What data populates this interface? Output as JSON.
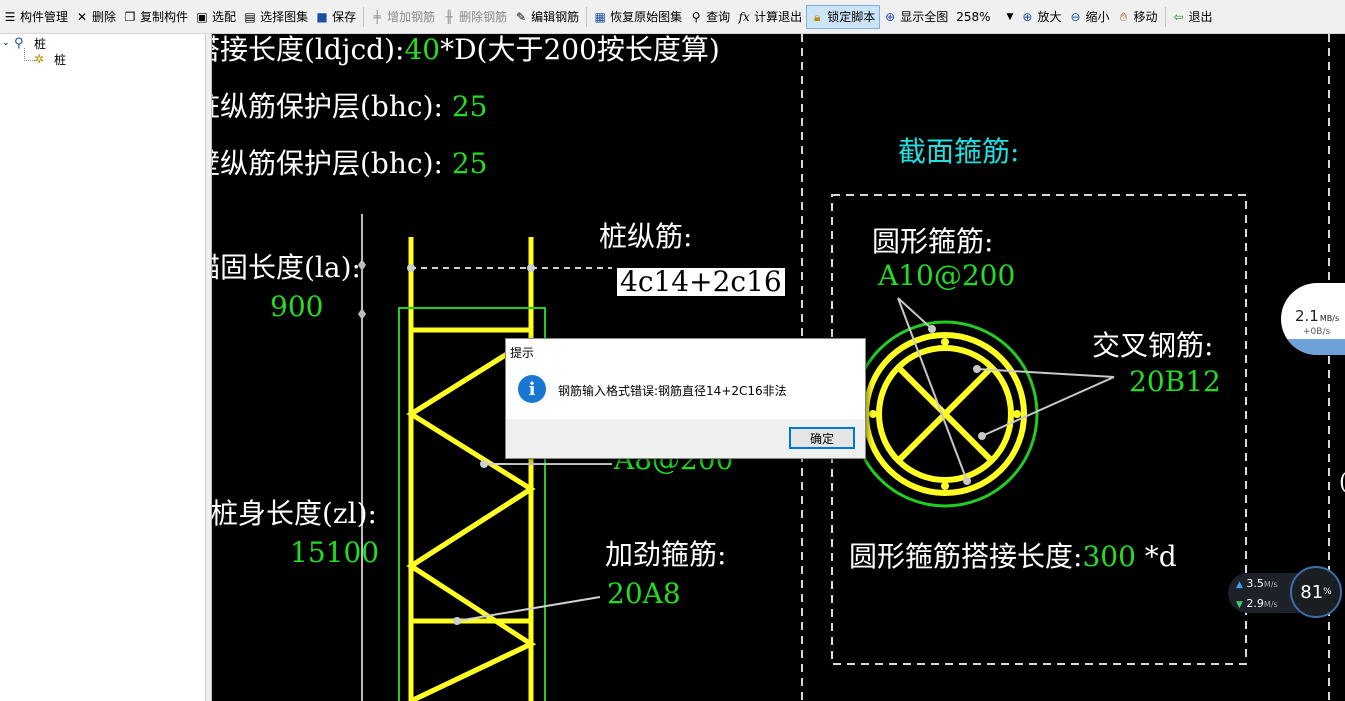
{
  "toolbar": {
    "items": [
      {
        "label": "构件管理",
        "icon": "component-manager-icon",
        "disabled": false
      },
      {
        "label": "删除",
        "icon": "delete-icon",
        "disabled": false
      },
      {
        "label": "复制构件",
        "icon": "copy-icon",
        "disabled": false
      },
      {
        "label": "选配",
        "icon": "select-match-icon",
        "disabled": false
      },
      {
        "label": "选择图集",
        "icon": "select-atlas-icon",
        "disabled": false
      },
      {
        "label": "保存",
        "icon": "save-icon",
        "disabled": false
      },
      {
        "label": "增加钢筋",
        "icon": "add-rebar-icon",
        "disabled": true
      },
      {
        "label": "删除钢筋",
        "icon": "delete-rebar-icon",
        "disabled": true
      },
      {
        "label": "编辑钢筋",
        "icon": "edit-rebar-icon",
        "disabled": false
      },
      {
        "label": "恢复原始图集",
        "icon": "restore-atlas-icon",
        "disabled": false
      },
      {
        "label": "查询",
        "icon": "query-icon",
        "disabled": false
      },
      {
        "label": "计算退出",
        "icon": "calc-exit-icon",
        "disabled": false
      },
      {
        "label": "锁定脚本",
        "icon": "lock-icon",
        "disabled": false,
        "active": true
      },
      {
        "label": "显示全图",
        "icon": "zoom-extents-icon",
        "disabled": false
      }
    ],
    "zoom_value": "258%",
    "items_after_zoom": [
      {
        "label": "放大",
        "icon": "zoom-in-icon"
      },
      {
        "label": "缩小",
        "icon": "zoom-out-icon"
      },
      {
        "label": "移动",
        "icon": "pan-hand-icon"
      },
      {
        "label": "退出",
        "icon": "exit-icon"
      }
    ]
  },
  "tree": {
    "root_label": "桩",
    "child_label": "桩"
  },
  "drawing": {
    "overlap_length": "搭接长度(ldjcd):",
    "overlap_value": "40",
    "overlap_suffix": "*D(大于200按长度算)",
    "long_cover_label": "桩纵筋保护层(bhc):",
    "long_cover_value": "25",
    "wall_cover_label": "桩壁纵筋保护层(bhc):",
    "wall_cover_value": "25",
    "section_stirrup_title": "截面箍筋:",
    "pile_long_rebar_label": "桩纵筋:",
    "pile_long_rebar_value": "4c14+2c16",
    "anchor_label": "锚固长度(la):",
    "anchor_value": "900",
    "circular_stirrup_label": "圆形箍筋:",
    "circular_stirrup_value": "A10@200",
    "cross_rebar_label": "交叉钢筋:",
    "cross_rebar_value": "20B12",
    "stirrup_value": "A8@200",
    "pile_body_label": "桩身长度(zl):",
    "pile_body_value": "15100",
    "stiffener_label": "加劲箍筋:",
    "stiffener_value": "20A8",
    "circular_overlap_label": "圆形箍筋搭接长度:",
    "circular_overlap_value": "300",
    "circular_overlap_suffix": "*d"
  },
  "dialog": {
    "title": "提示",
    "message": "钢筋输入格式错误:钢筋直径14+2C16非法",
    "ok_label": "确定"
  },
  "speed_widget": {
    "speed": "2.1",
    "unit": "MB/s",
    "sub": "+0B/s"
  },
  "net_widget": {
    "up": "3.5",
    "down": "2.9",
    "unit": "M/s",
    "percent": "81",
    "percent_sign": "%"
  },
  "colors": {
    "rebar_yellow": "#ffff22",
    "label_green": "#22dd22",
    "title_cyan": "#1ee0e0",
    "cover_green": "#22cc22"
  }
}
